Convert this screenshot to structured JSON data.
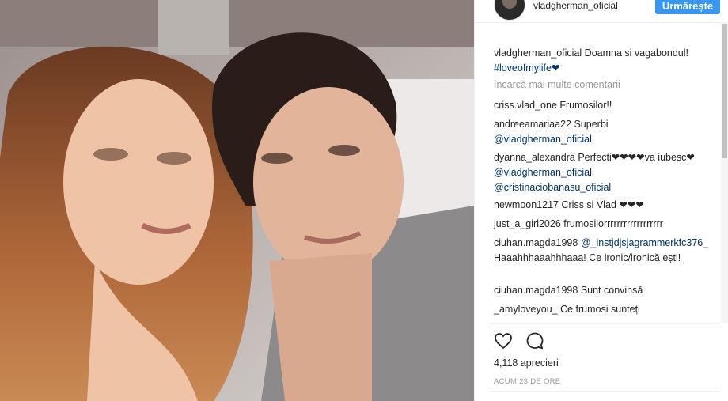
{
  "post": {
    "username": "vladgherman_oficial",
    "follow_label": "Urmărește",
    "caption_user": "vladgherman_oficial",
    "caption_text": "Doamna si vagabondul! ",
    "caption_emoji": "",
    "caption_hashtag": "#loveofmylife",
    "caption_heart": "❤",
    "load_more": "încarcă mai multe comentarii",
    "likes": "4,118 aprecieri",
    "time": "ACUM 23 DE ORE"
  },
  "comments": [
    {
      "user": "criss.vlad_one",
      "text": " Frumosilor!! "
    },
    {
      "user": "andreeamariaa22",
      "text": " Superbi",
      "mention": "@vladgherman_oficial"
    },
    {
      "user": "dyanna_alexandra",
      "text": " Perfecti❤❤❤❤va iubesc❤ ",
      "mention": "@vladgherman_oficial",
      "mention2": "@cristinaciobanasu_oficial"
    },
    {
      "user": "newmoon1217",
      "text": " Criss si Vlad ❤❤❤"
    },
    {
      "user": "just_a_girl2026",
      "text": " frumosilorrrrrrrrrrrrrrrrrr"
    },
    {
      "user": "ciuhan.magda1998",
      "text": " Haaahhhaaahhhaaa! Ce ironic/ironică ești!",
      "mention": "@_instjdjsjagrammerkfc376_"
    },
    {
      "user": "ciuhan.magda1998",
      "text": " Sunt convinsă"
    },
    {
      "user": "_amyloveyou_",
      "text": " Ce frumosi sunteți"
    }
  ]
}
